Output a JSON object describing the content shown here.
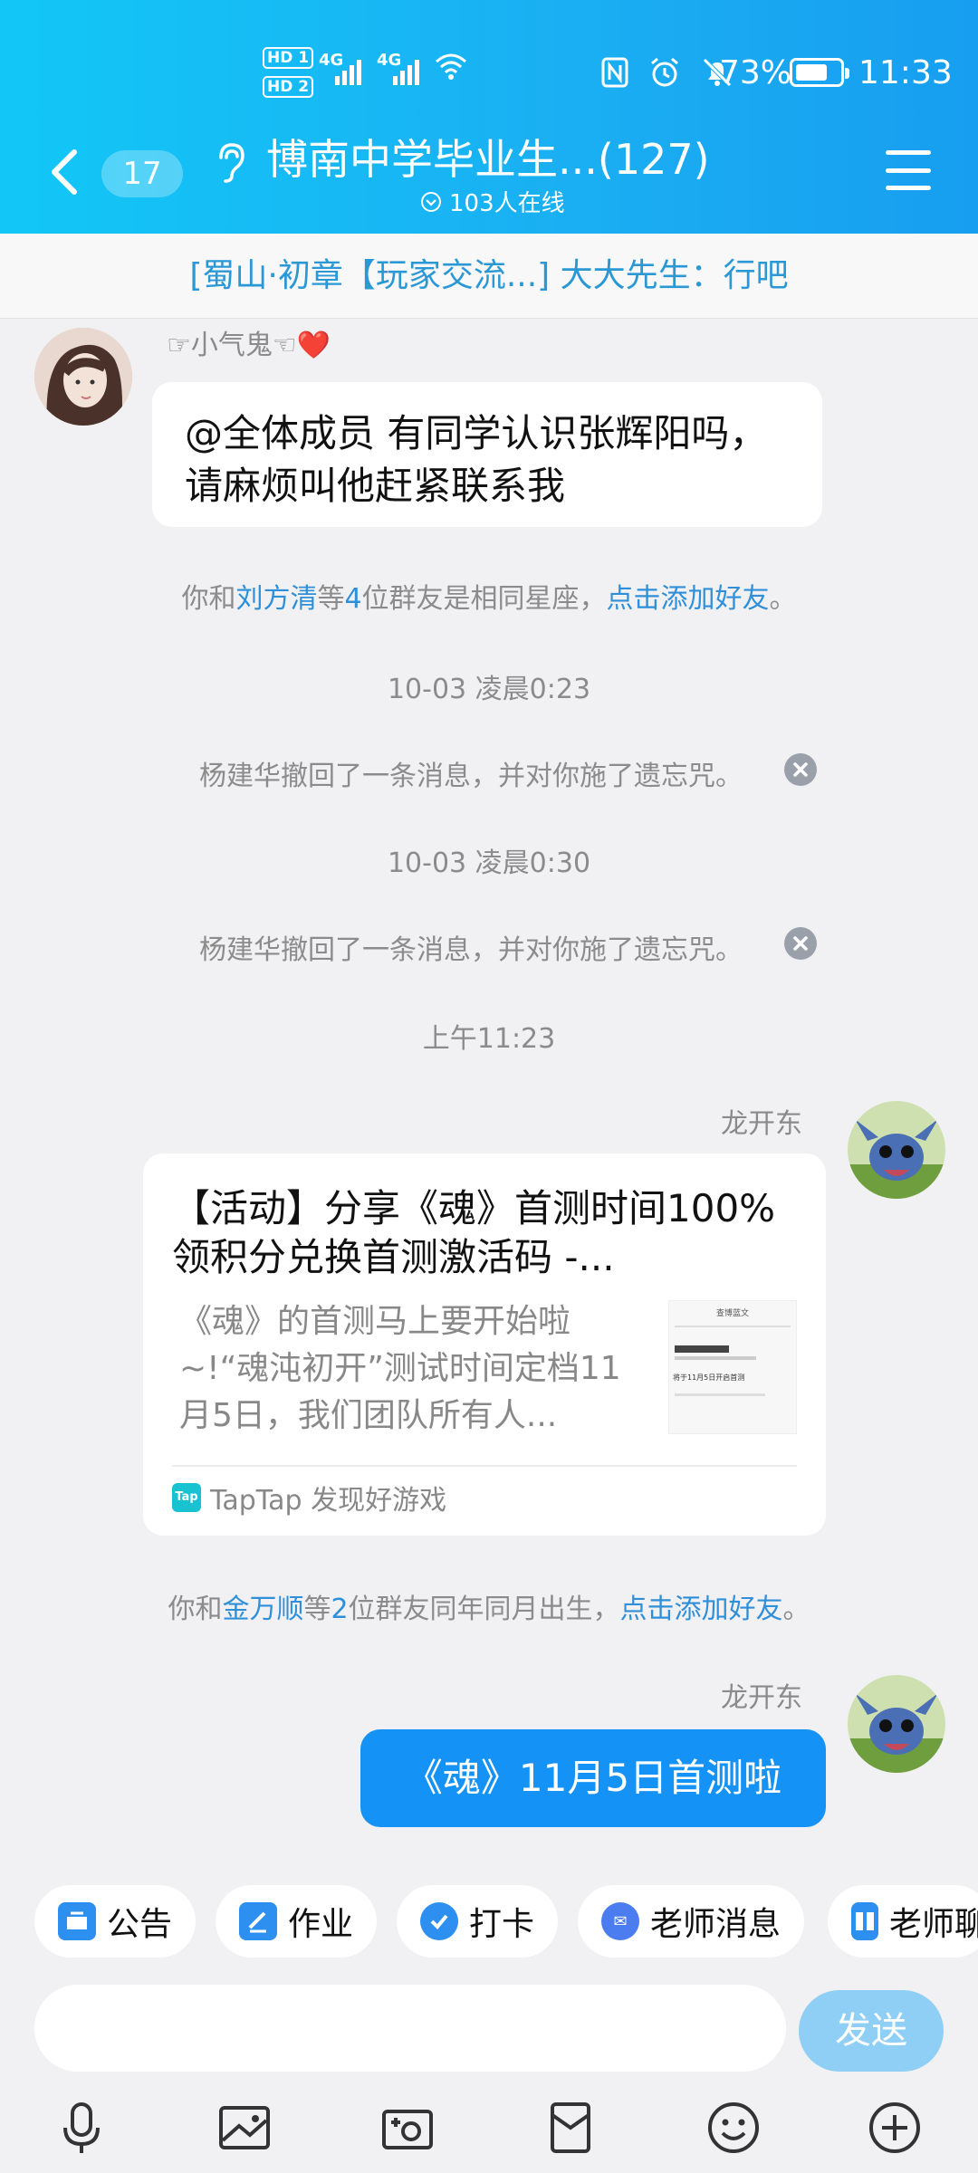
{
  "status_bar": {
    "sim1": "HD 1",
    "sim2": "HD 2",
    "net1": "4G",
    "net2": "4G",
    "battery": "73%",
    "time": "11:33"
  },
  "header": {
    "unread_count": "17",
    "title": "博南中学毕业生...(127)",
    "online": "103人在线"
  },
  "pinned": {
    "text": "[蜀山·初章【玩家交流...] 大大先生：行吧"
  },
  "messages": {
    "m1": {
      "sender": "☞小气鬼☜❤️",
      "text": "@全体成员 有同学认识张辉阳吗，请麻烦叫他赶紧联系我"
    },
    "sys1": {
      "pre": "你和",
      "name": "刘方清",
      "mid": "等",
      "count": "4",
      "post": "位群友是相同星座，",
      "link": "点击添加好友",
      "end": "。"
    },
    "time1": "10-03 凌晨0:23",
    "recall1": "杨建华撤回了一条消息，并对你施了遗忘咒。",
    "time2": "10-03 凌晨0:30",
    "recall2": "杨建华撤回了一条消息，并对你施了遗忘咒。",
    "time3": "上午11:23",
    "m2": {
      "sender": "龙开东",
      "card_title": "【活动】分享《魂》首测时间100%领积分兑换首测激活码 -...",
      "card_desc": "《魂》的首测马上要开始啦~!“魂沌初开”测试时间定档11月5日，我们团队所有人...",
      "thumb_header": "查博蓝文",
      "thumb_line": "将于11月5日开启首测",
      "source_logo": "Tap",
      "source": "TapTap 发现好游戏"
    },
    "sys2": {
      "pre": "你和",
      "name": "金万顺",
      "mid": "等",
      "count": "2",
      "post": "位群友同年同月出生，",
      "link": "点击添加好友",
      "end": "。"
    },
    "m3": {
      "sender": "龙开东",
      "text": "《魂》11月5日首测啦"
    }
  },
  "quickbar": {
    "notice": "公告",
    "homework": "作业",
    "checkin": "打卡",
    "teacher_msg": "老师消息",
    "teacher_more": "老师聊"
  },
  "composer": {
    "placeholder": "",
    "send": "发送"
  },
  "colors": {
    "header": "#1aaef2",
    "link": "#2f8fd8",
    "my_bubble": "#1592f6",
    "send_button": "#8fcff5"
  }
}
